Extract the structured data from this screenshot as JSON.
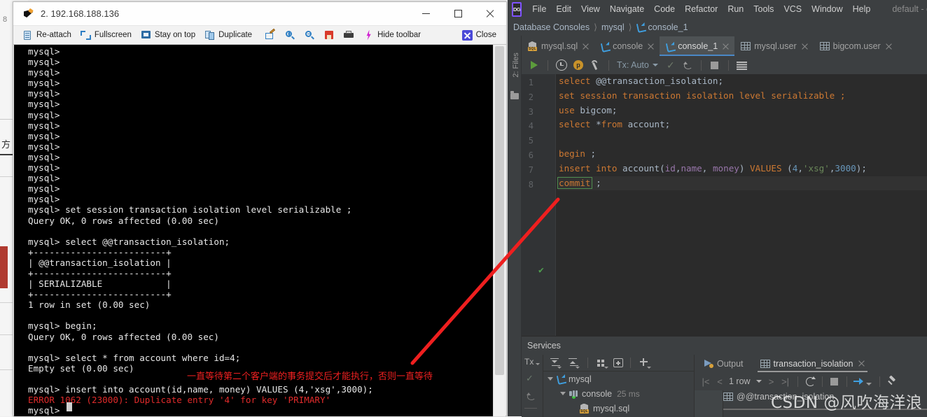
{
  "background_window": {
    "label_top": "8",
    "label_mid": "方"
  },
  "terminal": {
    "title": "2. 192.168.188.136",
    "window_controls": {
      "minimize": "minimize-icon",
      "maximize": "maximize-icon",
      "close": "close-icon"
    },
    "toolbar": [
      {
        "icon": "re-attach-icon",
        "label": "Re-attach"
      },
      {
        "icon": "fullscreen-icon",
        "label": "Fullscreen"
      },
      {
        "icon": "stay-on-top-icon",
        "label": "Stay on top"
      },
      {
        "icon": "duplicate-icon",
        "label": "Duplicate"
      },
      {
        "icon": "edit-icon",
        "label": ""
      },
      {
        "icon": "zoom-in-icon",
        "label": ""
      },
      {
        "icon": "zoom-out-icon",
        "label": ""
      },
      {
        "icon": "save-icon",
        "label": ""
      },
      {
        "icon": "print-icon",
        "label": ""
      },
      {
        "icon": "bolt-icon",
        "label": "Hide toolbar"
      }
    ],
    "close_button": {
      "icon": "close-x-icon",
      "label": "Close"
    },
    "content": "mysql>\nmysql>\nmysql>\nmysql>\nmysql>\nmysql>\nmysql>\nmysql>\nmysql>\nmysql>\nmysql>\nmysql>\nmysql>\nmysql>\nmysql>\nmysql> set session transaction isolation level serializable ;\nQuery OK, 0 rows affected (0.00 sec)\n\nmysql> select @@transaction_isolation;\n+-------------------------+\n| @@transaction_isolation |\n+-------------------------+\n| SERIALIZABLE            |\n+-------------------------+\n1 row in set (0.00 sec)\n\nmysql> begin;\nQuery OK, 0 rows affected (0.00 sec)\n\nmysql> select * from account where id=4;\nEmpty set (0.00 sec)\n\nmysql> insert into account(id,name, money) VALUES (4,'xsg',3000);",
    "error_line": "ERROR 1062 (23000): Duplicate entry '4' for key 'PRIMARY'",
    "prompt_line": "mysql> ",
    "annotation": "一直等待第二个客户端的事务提交后才能执行，否则一直等待",
    "annotation_color": "#ef2020"
  },
  "ide": {
    "logo": "datagrip-logo-icon",
    "menu": [
      "File",
      "Edit",
      "View",
      "Navigate",
      "Code",
      "Refactor",
      "Run",
      "Tools",
      "VCS",
      "Window",
      "Help"
    ],
    "app_name": "default - co",
    "breadcrumb": [
      "Database Consoles",
      "mysql",
      "console_1"
    ],
    "stripe": {
      "files_tab": "2: Files",
      "folder_icon": "folder-icon"
    },
    "tabs": [
      {
        "label": "mysql.sql",
        "icon": "sql-file-icon",
        "active": false
      },
      {
        "label": "console",
        "icon": "console-icon",
        "active": false
      },
      {
        "label": "console_1",
        "icon": "console-icon",
        "active": true
      },
      {
        "label": "mysql.user",
        "icon": "table-icon",
        "active": false
      },
      {
        "label": "bigcom.user",
        "icon": "table-icon",
        "active": false
      }
    ],
    "editor_toolbar": {
      "run": "run-icon",
      "history": "history-icon",
      "p_badge": "p",
      "settings": "wrench-icon",
      "tx_label": "Tx: Auto",
      "commit": "commit-icon",
      "rollback": "rollback-icon",
      "stop": "stop-icon",
      "grid": "table-view-icon"
    },
    "code_lines": [
      {
        "n": "1",
        "tokens": [
          {
            "t": "select ",
            "c": "kw"
          },
          {
            "t": "@@transaction_isolation",
            "c": "plain"
          },
          {
            "t": ";",
            "c": "plain"
          }
        ]
      },
      {
        "n": "2",
        "tokens": [
          {
            "t": "set session transaction isolation level serializable ;",
            "c": "kw"
          }
        ]
      },
      {
        "n": "3",
        "tokens": [
          {
            "t": "use ",
            "c": "kw"
          },
          {
            "t": "bigcom",
            "c": "plain"
          },
          {
            "t": ";",
            "c": "plain"
          }
        ]
      },
      {
        "n": "4",
        "tokens": [
          {
            "t": "select ",
            "c": "kw"
          },
          {
            "t": "*",
            "c": "plain"
          },
          {
            "t": "from ",
            "c": "kw"
          },
          {
            "t": "account",
            "c": "plain"
          },
          {
            "t": ";",
            "c": "plain"
          }
        ]
      },
      {
        "n": "5",
        "tokens": []
      },
      {
        "n": "6",
        "tokens": [
          {
            "t": "begin",
            "c": "kw"
          },
          {
            "t": " ;",
            "c": "plain"
          }
        ]
      },
      {
        "n": "7",
        "tokens": [
          {
            "t": "insert into ",
            "c": "kw"
          },
          {
            "t": "account",
            "c": "plain"
          },
          {
            "t": "(",
            "c": "plain"
          },
          {
            "t": "id",
            "c": "ident"
          },
          {
            "t": ",",
            "c": "plain"
          },
          {
            "t": "name",
            "c": "ident"
          },
          {
            "t": ", ",
            "c": "plain"
          },
          {
            "t": "money",
            "c": "ident"
          },
          {
            "t": ") ",
            "c": "plain"
          },
          {
            "t": "VALUES ",
            "c": "kw"
          },
          {
            "t": "(",
            "c": "plain"
          },
          {
            "t": "4",
            "c": "num"
          },
          {
            "t": ",",
            "c": "plain"
          },
          {
            "t": "'xsg'",
            "c": "str"
          },
          {
            "t": ",",
            "c": "plain"
          },
          {
            "t": "3000",
            "c": "num"
          },
          {
            "t": ");",
            "c": "plain"
          }
        ]
      },
      {
        "n": "8",
        "tokens": [
          {
            "t": "commit",
            "c": "kw boxed"
          },
          {
            "t": " ;",
            "c": "plain"
          }
        ],
        "highlight": true,
        "gutter_ok": "✔"
      }
    ],
    "services": {
      "title": "Services",
      "left_strip": {
        "tx": "Tx",
        "commit_icon": "commit-icon",
        "rollback_icon": "rollback-icon"
      },
      "tree_toolbar": [
        "expand-all-icon",
        "collapse-all-icon",
        "group-icon",
        "new-tab-icon",
        "add-icon"
      ],
      "tree": [
        {
          "label": "mysql",
          "icon": "console-icon",
          "indent": 0,
          "detail": ""
        },
        {
          "label": "console",
          "icon": "connection-icon",
          "indent": 1,
          "detail": "25 ms"
        },
        {
          "label": "mysql.sql",
          "icon": "sql-file-icon",
          "indent": 2,
          "detail": ""
        }
      ],
      "result_tabs": [
        {
          "label": "Output",
          "icon": "output-icon",
          "active": false
        },
        {
          "label": "transaction_isolation",
          "icon": "table-icon",
          "active": true
        }
      ],
      "result_toolbar": {
        "first": "first-page-icon",
        "prev": "prev-page-icon",
        "row_count": "1 row",
        "next": "next-page-icon",
        "last": "last-page-icon",
        "refresh": "refresh-icon",
        "stop": "stop-icon",
        "commit": "tx-commit-icon",
        "pin": "pin-icon"
      },
      "grid_column": "@@transaction_isolation"
    }
  },
  "annotations": {
    "arrow_color": "#ef1f1f"
  },
  "watermark": "CSDN @风吹海洋浪"
}
